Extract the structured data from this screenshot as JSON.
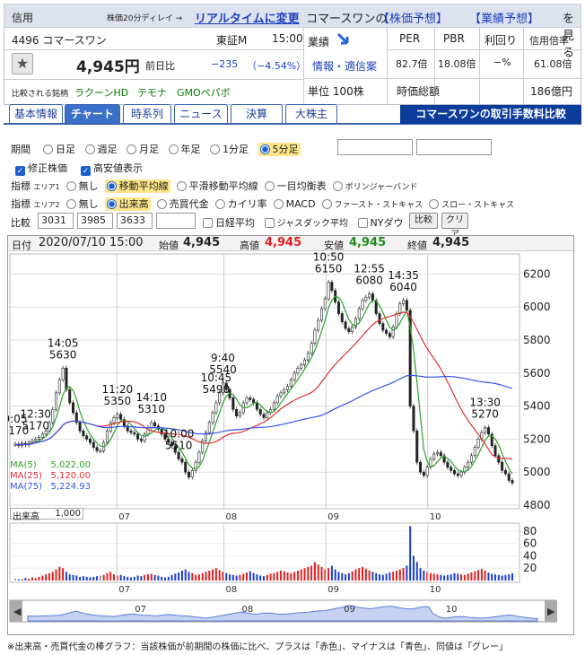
{
  "header": {
    "label": "信用",
    "delay_note": "株価20分ディレイ →",
    "realtime_link": "リアルタイムに変更",
    "company_the": "コマースワンの",
    "yosou_link": "【株価予想】",
    "gyoseki_link": "【業績予想】",
    "miru": "を見る"
  },
  "stock": {
    "code_name": "4496 コマースワン",
    "market": "東証M",
    "time": "15:00",
    "price": "4,945円",
    "change_label": "前日比",
    "change": "−235",
    "change_pct": "（−4.54%）",
    "gyoseki_label": "業績",
    "info_link": "情報・適信案",
    "unit": "単位 100株",
    "per_label": "PER",
    "per": "82.7倍",
    "pbr_label": "PBR",
    "pbr": "18.08倍",
    "yield_label": "利回り",
    "yield": "−%",
    "margin_label": "信用倍率",
    "margin": "61.08倍",
    "mcap_label": "時価総額",
    "mcap": "186億円",
    "compare_label": "比較される銘柄",
    "compare": [
      "ラクーンHD",
      "テモナ",
      "GMOペパボ"
    ]
  },
  "tabs": [
    "基本情報",
    "チャート",
    "時系列",
    "ニュース",
    "決算",
    "大株主"
  ],
  "promo": "コマースワンの取引手数料比較",
  "controls": {
    "period_label": "期間",
    "periods": [
      "日足",
      "週足",
      "月足",
      "年足",
      "1分足",
      "5分足"
    ],
    "opt1": "修正株価",
    "opt2": "高安値表示",
    "ind_label": "指標",
    "area1": "エリア1",
    "area1_items": [
      "無し",
      "移動平均線",
      "平滑移動平均線",
      "一目均衡表",
      "ボリンジャーバンド"
    ],
    "area2": "エリア2",
    "area2_items": [
      "無し",
      "出来高",
      "売買代金",
      "カイリ率",
      "MACD",
      "ファースト・ストキャス",
      "スロー・ストキャス"
    ],
    "compare_label": "比較",
    "compare_codes": [
      "3031",
      "3985",
      "3633",
      ""
    ],
    "nikkei": "日経平均",
    "jasdaq": "ジャスダック平均",
    "nydow": "NYダウ",
    "btn_compare": "比較",
    "btn_clear": "クリア"
  },
  "ohlc": {
    "date_label": "日付",
    "date": "2020/07/10 15:00",
    "open_label": "始値",
    "open": "4,945",
    "high_label": "高値",
    "high": "4,945",
    "low_label": "安値",
    "low": "4,945",
    "close_label": "終値",
    "close": "4,945"
  },
  "legend": {
    "ma5_label": "MA(5)",
    "ma5": "5,022.00",
    "ma25_label": "MA(25)",
    "ma25": "5,120.00",
    "ma75_label": "MA(75)",
    "ma75": "5,224.93"
  },
  "volume": {
    "label": "出来高",
    "scale": "1,000"
  },
  "footnote": "※出来高・売買代金の棒グラフ：当該株価が前期間の株価に比べ、プラスは「赤色」、マイナスは「青色」、同値は「グレー」",
  "colors": {
    "up": "#e02020",
    "down": "#1a3fd0",
    "ma5": "#29a329",
    "ma25": "#e03030",
    "ma75": "#3355ee",
    "accent": "#1d3fbf",
    "promo_bg": "#0c3c9a"
  },
  "chart_data": {
    "type": "line",
    "interval": "5分足",
    "ylim": [
      4800,
      6300
    ],
    "price_ticks": [
      4800,
      5000,
      5200,
      5400,
      5600,
      5800,
      6000,
      6200
    ],
    "x_labels": [
      "07",
      "08",
      "09",
      "10"
    ],
    "close": [
      5170,
      5160,
      5175,
      5165,
      5180,
      5190,
      5200,
      5210,
      5230,
      5250,
      5300,
      5380,
      5480,
      5560,
      5630,
      5500,
      5420,
      5360,
      5300,
      5250,
      5220,
      5200,
      5180,
      5150,
      5130,
      5130,
      5180,
      5250,
      5300,
      5330,
      5350,
      5320,
      5280,
      5250,
      5240,
      5230,
      5200,
      5190,
      5230,
      5270,
      5300,
      5280,
      5260,
      5230,
      5200,
      5180,
      5160,
      5120,
      5080,
      5060,
      5000,
      4970,
      5010,
      5060,
      5120,
      5190,
      5240,
      5300,
      5360,
      5420,
      5480,
      5540,
      5500,
      5450,
      5380,
      5340,
      5360,
      5420,
      5450,
      5440,
      5420,
      5380,
      5350,
      5330,
      5360,
      5380,
      5420,
      5460,
      5480,
      5500,
      5520,
      5560,
      5600,
      5630,
      5650,
      5680,
      5720,
      5780,
      5860,
      5920,
      5990,
      6050,
      6150,
      6100,
      6030,
      5960,
      5910,
      5870,
      5850,
      5880,
      5930,
      5990,
      6040,
      6060,
      6080,
      6040,
      5960,
      5900,
      5860,
      5840,
      5820,
      5880,
      5960,
      6020,
      6040,
      5980,
      5400,
      5250,
      5060,
      5000,
      4980,
      5030,
      5080,
      5110,
      5120,
      5100,
      5060,
      5030,
      5010,
      4990,
      4980,
      5000,
      5030,
      5060,
      5100,
      5150,
      5200,
      5240,
      5270,
      5230,
      5160,
      5100,
      5060,
      5010,
      4990,
      4950,
      4935
    ],
    "volume": [
      3,
      2,
      2,
      4,
      3,
      5,
      4,
      6,
      8,
      10,
      12,
      14,
      18,
      22,
      20,
      14,
      10,
      9,
      8,
      6,
      7,
      6,
      5,
      6,
      7,
      8,
      9,
      12,
      14,
      10,
      8,
      9,
      7,
      6,
      5,
      6,
      8,
      7,
      9,
      10,
      11,
      9,
      8,
      6,
      5,
      6,
      9,
      11,
      13,
      16,
      18,
      14,
      12,
      9,
      10,
      12,
      14,
      16,
      18,
      20,
      17,
      14,
      12,
      10,
      9,
      8,
      9,
      11,
      13,
      15,
      12,
      10,
      8,
      7,
      9,
      11,
      12,
      14,
      16,
      15,
      13,
      12,
      14,
      16,
      18,
      20,
      22,
      24,
      30,
      26,
      22,
      18,
      20,
      24,
      18,
      14,
      12,
      10,
      12,
      15,
      18,
      20,
      22,
      19,
      16,
      14,
      12,
      10,
      9,
      11,
      13,
      14,
      16,
      18,
      20,
      24,
      88,
      40,
      30,
      20,
      16,
      14,
      12,
      11,
      10,
      9,
      8,
      9,
      10,
      12,
      11,
      10,
      9,
      11,
      13,
      15,
      17,
      19,
      16,
      13,
      11,
      10,
      9,
      8,
      9,
      10,
      12
    ]
  },
  "annotations": [
    {
      "t": "14:05",
      "v": "5630"
    },
    {
      "t": "10:00",
      "v": "5510"
    },
    {
      "t": "11:20",
      "v": "5350"
    },
    {
      "t": "14:10",
      "v": "5310"
    },
    {
      "t": "9:40",
      "v": "5540"
    },
    {
      "t": "10:45",
      "v": "5490"
    },
    {
      "t": "10:50",
      "v": "6150"
    },
    {
      "t": "12:55",
      "v": "6080"
    },
    {
      "t": "14:35",
      "v": "6040"
    },
    {
      "t": "9:05",
      "v": "5170"
    },
    {
      "t": "12:30",
      "v": "5170"
    },
    {
      "t": "13:30",
      "v": "5270"
    }
  ]
}
